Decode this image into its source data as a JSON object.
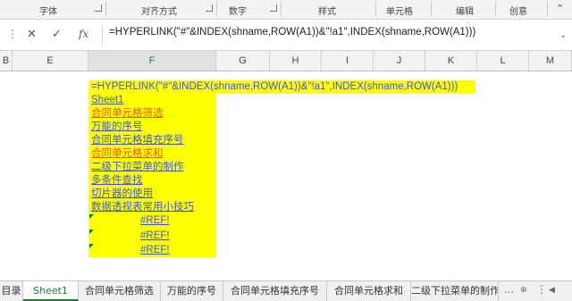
{
  "ribbon": {
    "groups": [
      "字体",
      "对齐方式",
      "数字",
      "样式",
      "单元格",
      "编辑",
      "创意"
    ]
  },
  "formula_bar": {
    "cancel_glyph": "✕",
    "enter_glyph": "✓",
    "fx_label": "fx",
    "formula": "=HYPERLINK(\"#\"&INDEX(shname,ROW(A1))&\"!a1\",INDEX(shname,ROW(A1)))"
  },
  "columns": [
    "B",
    "E",
    "F",
    "G",
    "H",
    "I",
    "J",
    "K",
    "L",
    "M"
  ],
  "cells": {
    "formula_text": "=HYPERLINK(\"#\"&INDEX(shname,ROW(A1))&\"!a1\",INDEX(shname,ROW(A1)))",
    "links": [
      "Sheet1",
      "合同单元格筛选",
      "万能的序号",
      "合同单元格填充序号",
      "合同单元格求和",
      "二级下拉菜单的制作",
      "多条件查找",
      "切片器的使用",
      "数据透视表常用小技巧"
    ],
    "refs": [
      "#REF!",
      "#REF!",
      "#REF!"
    ]
  },
  "sheet_tabs": [
    "目录",
    "Sheet1",
    "合同单元格筛选",
    "万能的序号",
    "合同单元格填充序号",
    "合同单元格求和",
    "二级下拉菜单的制作"
  ],
  "colors": {
    "highlight": "#ffff00",
    "link": "#3a5ad8",
    "link_visited": "#e85a1b",
    "accent": "#1e7b34"
  }
}
